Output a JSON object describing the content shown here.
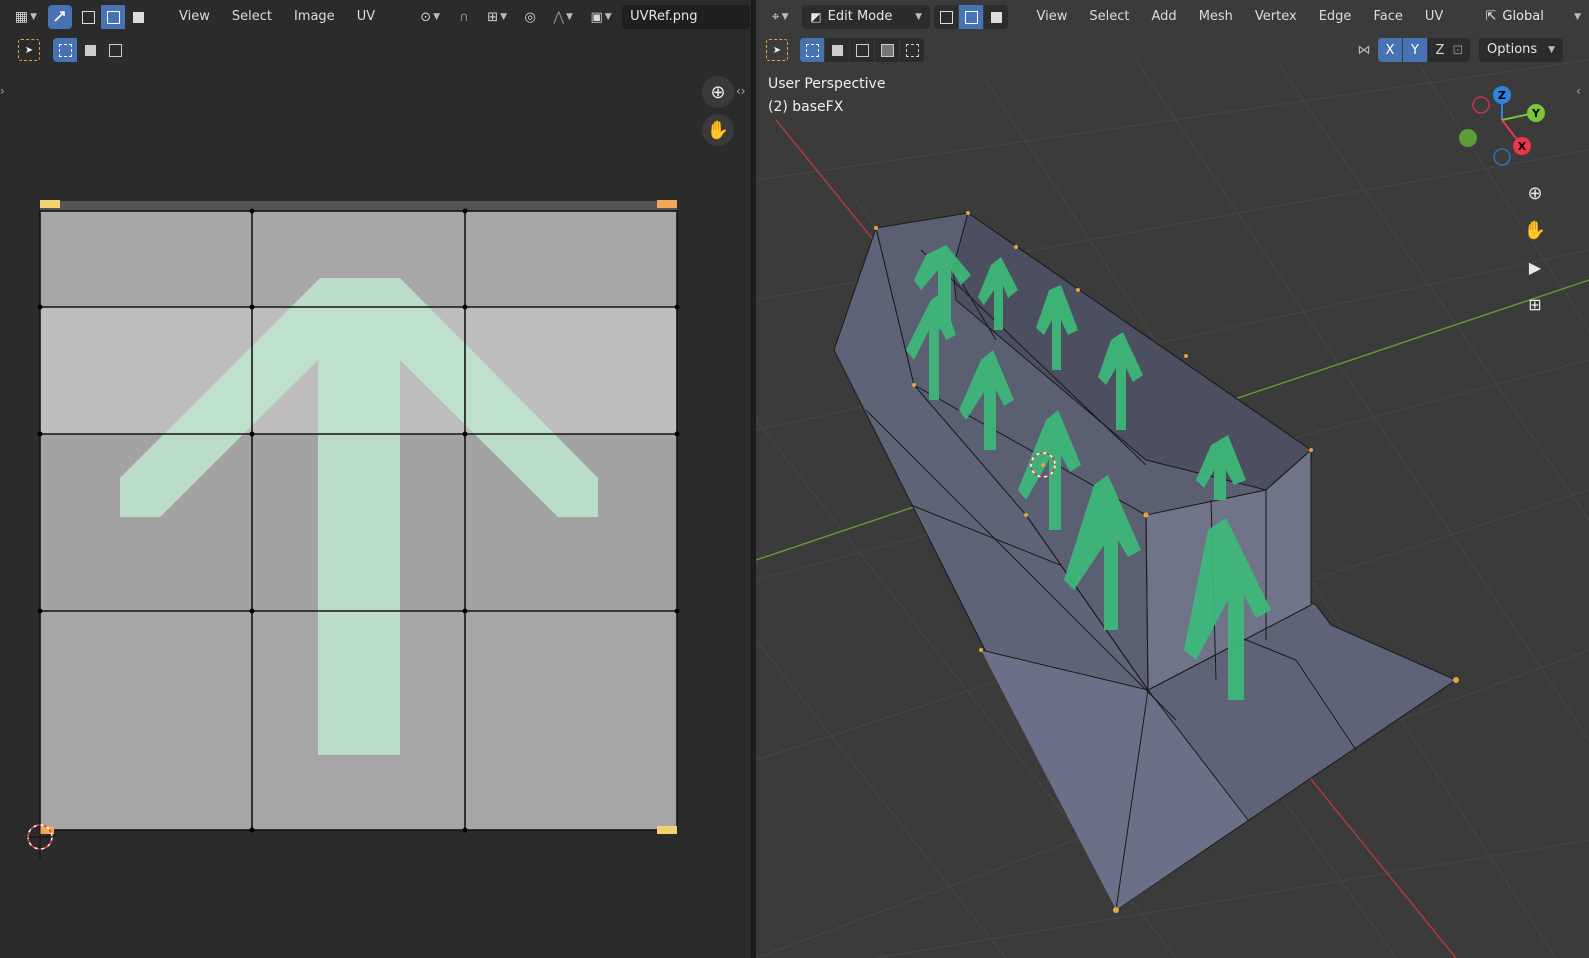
{
  "uv_editor": {
    "header": {
      "menus": [
        "View",
        "Select",
        "Image",
        "UV"
      ],
      "image_name": "UVRef.png"
    },
    "navigation": [
      "zoom-icon",
      "hand-pan-icon"
    ]
  },
  "viewport": {
    "header": {
      "mode": "Edit Mode",
      "menus": [
        "View",
        "Select",
        "Add",
        "Mesh",
        "Vertex",
        "Edge",
        "Face",
        "UV"
      ],
      "orientation": "Global"
    },
    "tool_row": {
      "axes": [
        "X",
        "Y",
        "Z"
      ],
      "options_label": "Options"
    },
    "overlay": {
      "view_name": "User Perspective",
      "object_name": "(2) baseFX"
    },
    "gizmo": {
      "axes": [
        "Z",
        "Y",
        "X"
      ],
      "colors": {
        "x": "#e8384a",
        "y": "#7cc43a",
        "z": "#2f83e0"
      }
    },
    "navigation": [
      "zoom-icon",
      "hand-pan-icon",
      "camera-icon",
      "grid-view-icon"
    ]
  },
  "colors": {
    "accent": "#4772b3",
    "arrow": "#8ed9a8",
    "selection": "#e8a33b"
  }
}
